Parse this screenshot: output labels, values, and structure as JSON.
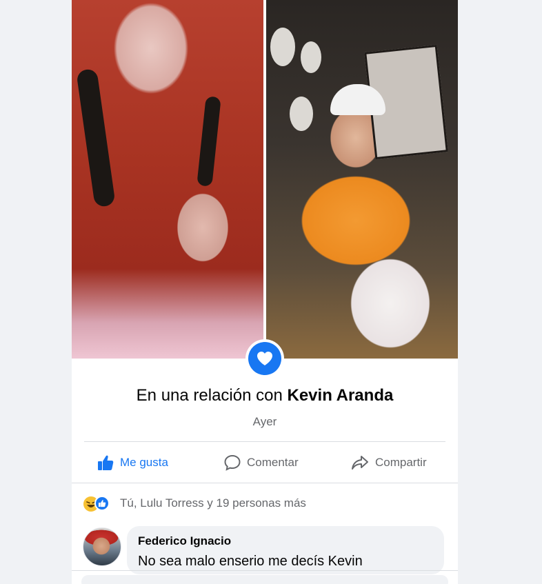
{
  "post": {
    "status_prefix": "En una relación con",
    "partner_name": "Kevin Aranda",
    "time": "Ayer"
  },
  "actions": {
    "like": "Me gusta",
    "comment": "Comentar",
    "share": "Compartir"
  },
  "reactions": {
    "summary": "Tú, Lulu Torress y 19 personas más",
    "icons": [
      "haha-icon",
      "like-icon"
    ]
  },
  "comments": [
    {
      "author": "Federico Ignacio",
      "text": "No sea malo enserio me decís Kevin"
    }
  ],
  "colors": {
    "accent": "#1877f2",
    "muted": "#65676b",
    "bubble": "#f0f2f5"
  }
}
